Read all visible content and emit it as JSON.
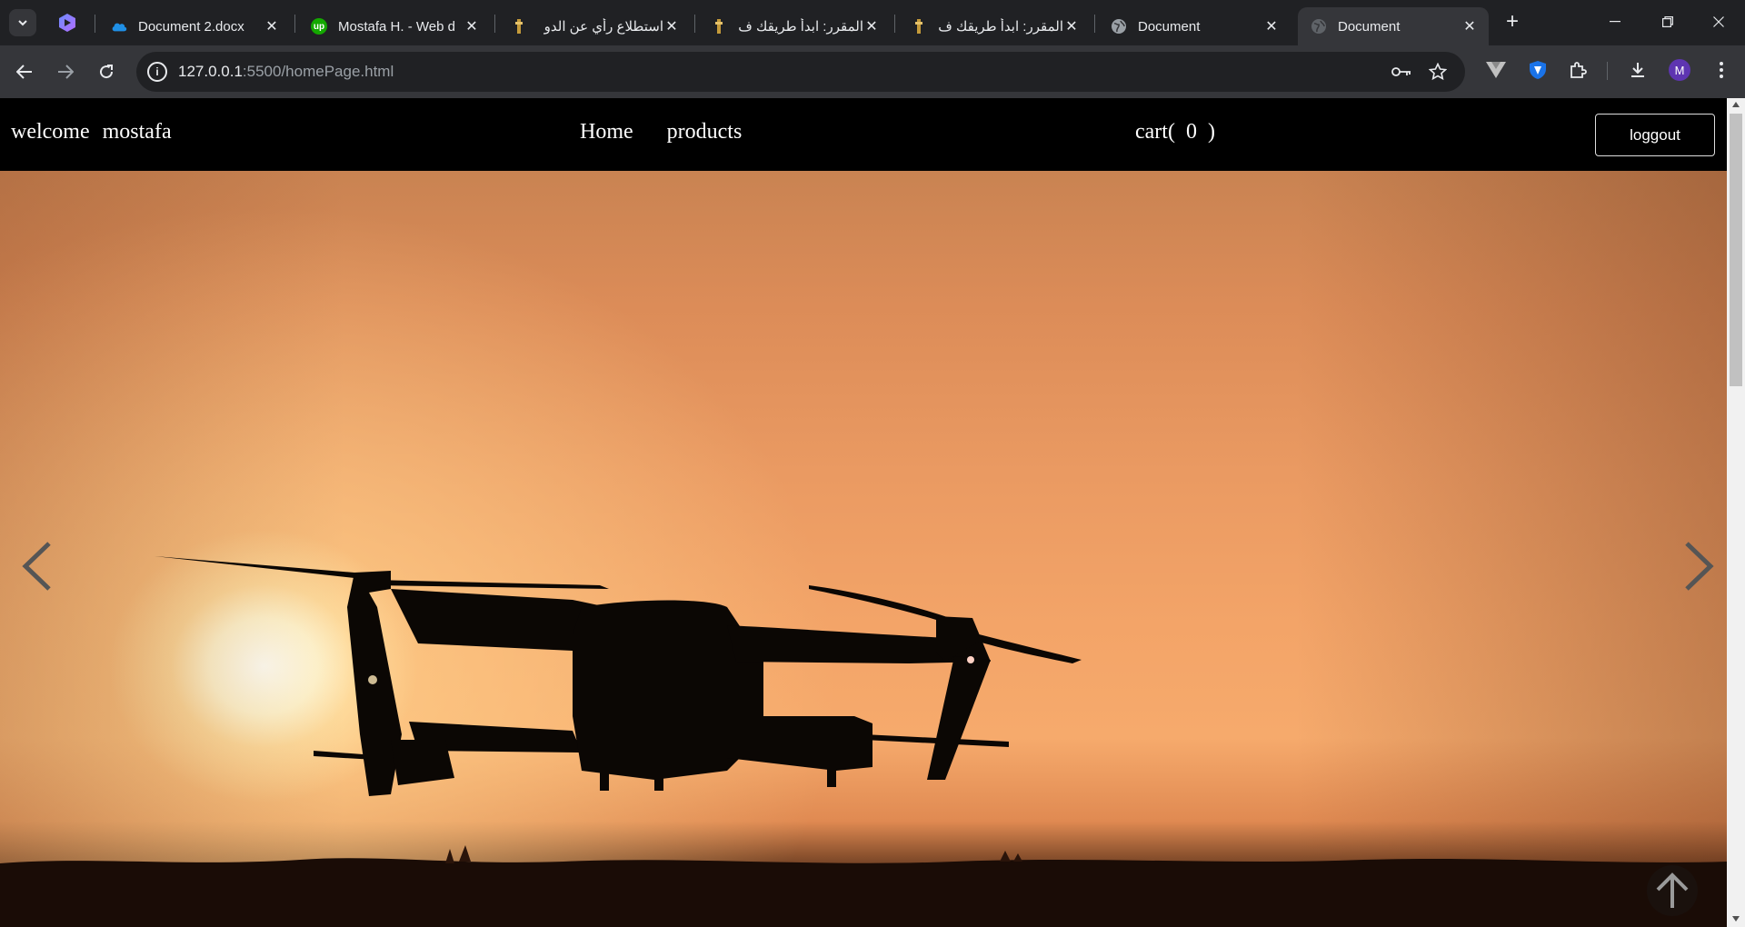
{
  "browser": {
    "tabs": [
      {
        "title": "Document 2.docx",
        "icon": "onedrive-icon",
        "active": false
      },
      {
        "title": "Mostafa H. - Web d",
        "icon": "upwork-icon",
        "active": false
      },
      {
        "title": "استطلاع رأي عن الدو",
        "icon": "course-icon",
        "active": false
      },
      {
        "title": "المقرر: ابدأ طريقك ف",
        "icon": "course-icon",
        "active": false
      },
      {
        "title": "المقرر: ابدأ طريقك ف",
        "icon": "course-icon",
        "active": false
      },
      {
        "title": "Document",
        "icon": "globe-icon",
        "active": false
      },
      {
        "title": "Document",
        "icon": "globe-icon",
        "active": true
      }
    ],
    "url_host": "127.0.0.1",
    "url_rest": ":5500/homePage.html",
    "profile_initial": "M"
  },
  "site": {
    "welcome_label": "welcome",
    "username": "mostafa",
    "nav": {
      "home": "Home",
      "products": "products"
    },
    "cart_label": "cart(",
    "cart_count": "0",
    "cart_close": ")",
    "logout_label": "loggout"
  },
  "colors": {
    "navbar_bg": "#000000",
    "chrome_bg": "#202124",
    "toolbar_bg": "#35363a",
    "sky": "#f3a468"
  }
}
